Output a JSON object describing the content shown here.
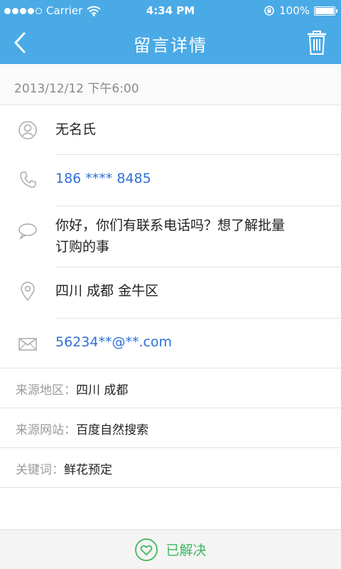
{
  "status_bar": {
    "carrier": "Carrier",
    "time": "4:34 PM",
    "battery": "100%",
    "battery_level": 1.0,
    "signal_bars": 4,
    "icons": [
      "signal-dots-icon",
      "wifi-icon",
      "orientation-lock-icon",
      "battery-icon"
    ]
  },
  "nav": {
    "title": "留言详情",
    "icons": [
      "back-arrow-icon",
      "trash-icon"
    ]
  },
  "message": {
    "date": "2013/12/12  下午6:00",
    "name": "无名氏",
    "phone": "186  **** 8485",
    "content_line1": "你好，你们有联系电话吗？想了解批量",
    "content_line2": "订购的事",
    "location": "四川 成都 金牛区",
    "email": "56234**@**.com",
    "icons": [
      "user-icon",
      "phone-icon",
      "chat-bubble-icon",
      "location-pin-icon",
      "mail-icon"
    ]
  },
  "details": [
    {
      "label": "来源地区：",
      "value": "四川  成都"
    },
    {
      "label": "来源网站：",
      "value": "百度自然搜索"
    },
    {
      "label": "关键词：",
      "value": "鲜花预定"
    }
  ],
  "footer": {
    "label": "已解决",
    "icon": "heart-circle-icon"
  },
  "colors": {
    "header": "#4aaae6",
    "link": "#2f6fd6",
    "resolved": "#3db85e",
    "muted": "#8a8a8a"
  }
}
